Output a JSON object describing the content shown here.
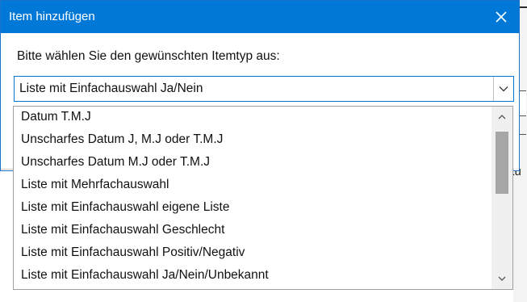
{
  "dialog": {
    "title": "Item hinzufügen",
    "prompt": "Bitte wählen Sie den gewünschten Itemtyp aus:",
    "combo_value": "Liste mit Einfachauswahl Ja/Nein"
  },
  "dropdown": {
    "items": [
      "Datum T.M.J",
      "Unscharfes Datum J, M.J oder T.M.J",
      "Unscharfes Datum M.J oder T.M.J",
      "Liste mit Mehrfachauswahl",
      "Liste mit Einfachauswahl eigene Liste",
      "Liste mit Einfachauswahl Geschlecht",
      "Liste mit Einfachauswahl Positiv/Negativ",
      "Liste mit Einfachauswahl Ja/Nein/Unbekannt"
    ]
  },
  "background": {
    "partial_text": "ku"
  },
  "colors": {
    "titlebar": "#0078d7",
    "accent_border": "#0078d7",
    "scroll_thumb": "#a6a6a6"
  }
}
